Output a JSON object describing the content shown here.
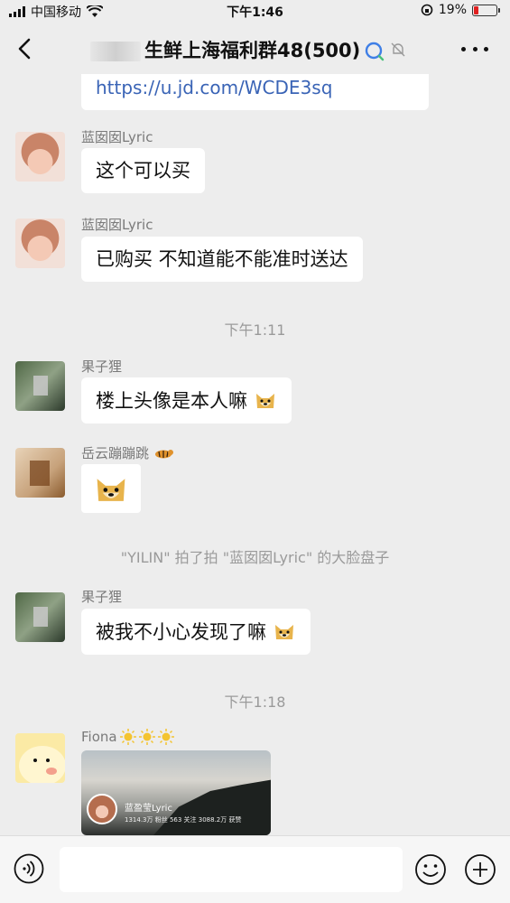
{
  "status_bar": {
    "carrier": "中国移动",
    "time": "下午1:46",
    "battery": "19%",
    "battery_level": 0.19,
    "battery_color": "#e02020"
  },
  "nav": {
    "title": "生鲜上海福利群48(500)",
    "back_icon": "chevron-left-icon",
    "more_icon": "more-dots-icon"
  },
  "messages": {
    "m0": {
      "text": "https://u.jd.com/WCDE3sq"
    },
    "m1": {
      "sender": "蓝囡囡Lyric",
      "text": "这个可以买"
    },
    "m2": {
      "sender": "蓝囡囡Lyric",
      "text": "已购买 不知道能不能准时送达"
    },
    "t1": "下午1:11",
    "m3": {
      "sender": "果子狸",
      "text": "楼上头像是本人嘛"
    },
    "m4": {
      "sender": "岳云蹦蹦跳"
    },
    "sys1": "\"YILIN\" 拍了拍 \"蓝囡囡Lyric\" 的大脸盘子",
    "m5": {
      "sender": "果子狸",
      "text": "被我不小心发现了嘛"
    },
    "t2": "下午1:18",
    "m6": {
      "sender": "Fiona"
    }
  },
  "image_card": {
    "profile_name": "蓝盈莹Lyric",
    "stats": "1314.3万 粉丝   563 关注   3088.2万 获赞"
  },
  "input_bar": {
    "placeholder": "",
    "voice_icon": "voice-icon",
    "emoji_icon": "emoji-icon",
    "plus_icon": "plus-icon"
  },
  "colors": {
    "background": "#ededed",
    "bubble": "#ffffff",
    "link": "#3a64b6"
  }
}
